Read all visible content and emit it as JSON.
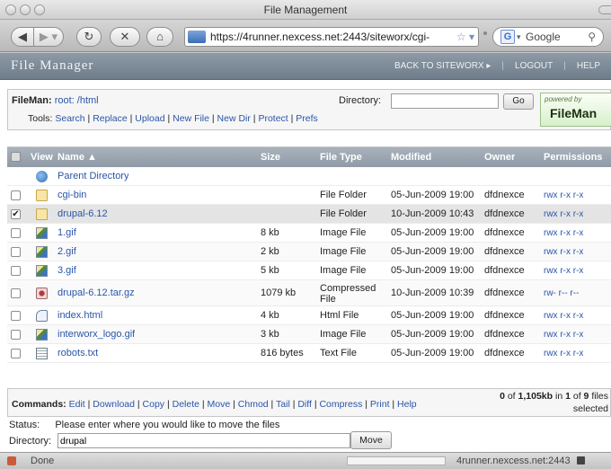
{
  "window": {
    "title": "File Management"
  },
  "browser": {
    "url": "https://4runner.nexcess.net:2443/siteworx/cgi-",
    "search_placeholder": "Google"
  },
  "header": {
    "brand": "File Manager",
    "links": [
      "BACK TO SITEWORX ▸",
      "LOGOUT",
      "HELP"
    ]
  },
  "filemanager": {
    "label": "FileMan:",
    "path_root": "root:",
    "path_dir": "/html",
    "directory_label": "Directory:",
    "go_label": "Go",
    "tools_label": "Tools:",
    "tools": [
      "Search",
      "Replace",
      "Upload",
      "New File",
      "New Dir",
      "Protect",
      "Prefs"
    ],
    "powered_by": "powered by",
    "powered_name": "FileMan"
  },
  "table": {
    "columns": [
      "View",
      "Name ▲",
      "Size",
      "File Type",
      "Modified",
      "Owner",
      "Permissions"
    ],
    "parent_label": "Parent Directory",
    "rows": [
      {
        "name": "cgi-bin",
        "size": "",
        "type": "File Folder",
        "modified": "05-Jun-2009 19:00",
        "owner": "dfdnexce",
        "perms": "rwx r-x r-x",
        "checked": "",
        "icon": "folder-icon"
      },
      {
        "name": "drupal-6.12",
        "size": "",
        "type": "File Folder",
        "modified": "10-Jun-2009 10:43",
        "owner": "dfdnexce",
        "perms": "rwx r-x r-x",
        "checked": "✔",
        "icon": "folder-icon"
      },
      {
        "name": "1.gif",
        "size": "8 kb",
        "type": "Image File",
        "modified": "05-Jun-2009 19:00",
        "owner": "dfdnexce",
        "perms": "rwx r-x r-x",
        "checked": "",
        "icon": "image-file-icon"
      },
      {
        "name": "2.gif",
        "size": "2 kb",
        "type": "Image File",
        "modified": "05-Jun-2009 19:00",
        "owner": "dfdnexce",
        "perms": "rwx r-x r-x",
        "checked": "",
        "icon": "image-file-icon"
      },
      {
        "name": "3.gif",
        "size": "5 kb",
        "type": "Image File",
        "modified": "05-Jun-2009 19:00",
        "owner": "dfdnexce",
        "perms": "rwx r-x r-x",
        "checked": "",
        "icon": "image-file-icon"
      },
      {
        "name": "drupal-6.12.tar.gz",
        "size": "1079 kb",
        "type": "Compressed File",
        "modified": "10-Jun-2009 10:39",
        "owner": "dfdnexce",
        "perms": "rw- r-- r--",
        "checked": "",
        "icon": "archive-file-icon"
      },
      {
        "name": "index.html",
        "size": "4 kb",
        "type": "Html File",
        "modified": "05-Jun-2009 19:00",
        "owner": "dfdnexce",
        "perms": "rwx r-x r-x",
        "checked": "",
        "icon": "html-file-icon"
      },
      {
        "name": "interworx_logo.gif",
        "size": "3 kb",
        "type": "Image File",
        "modified": "05-Jun-2009 19:00",
        "owner": "dfdnexce",
        "perms": "rwx r-x r-x",
        "checked": "",
        "icon": "image-file-icon"
      },
      {
        "name": "robots.txt",
        "size": "816 bytes",
        "type": "Text File",
        "modified": "05-Jun-2009 19:00",
        "owner": "dfdnexce",
        "perms": "rwx r-x r-x",
        "checked": "",
        "icon": "text-file-icon"
      }
    ]
  },
  "commands": {
    "label": "Commands:",
    "items": [
      "Edit",
      "Download",
      "Copy",
      "Delete",
      "Move",
      "Chmod",
      "Tail",
      "Diff",
      "Compress",
      "Print",
      "Help"
    ],
    "summary_a": "0",
    "summary_b": "of",
    "summary_c": "1,105kb",
    "summary_d": "in",
    "summary_e": "1",
    "summary_f": "of",
    "summary_g": "9",
    "summary_h": "files",
    "summary_i": "selected"
  },
  "status": {
    "label": "Status:",
    "message": "Please enter where you would like to move the files",
    "directory_label": "Directory:",
    "directory_value": "drupal",
    "move_label": "Move"
  },
  "statusbar": {
    "left": "Done",
    "right": "4runner.nexcess.net:2443"
  }
}
